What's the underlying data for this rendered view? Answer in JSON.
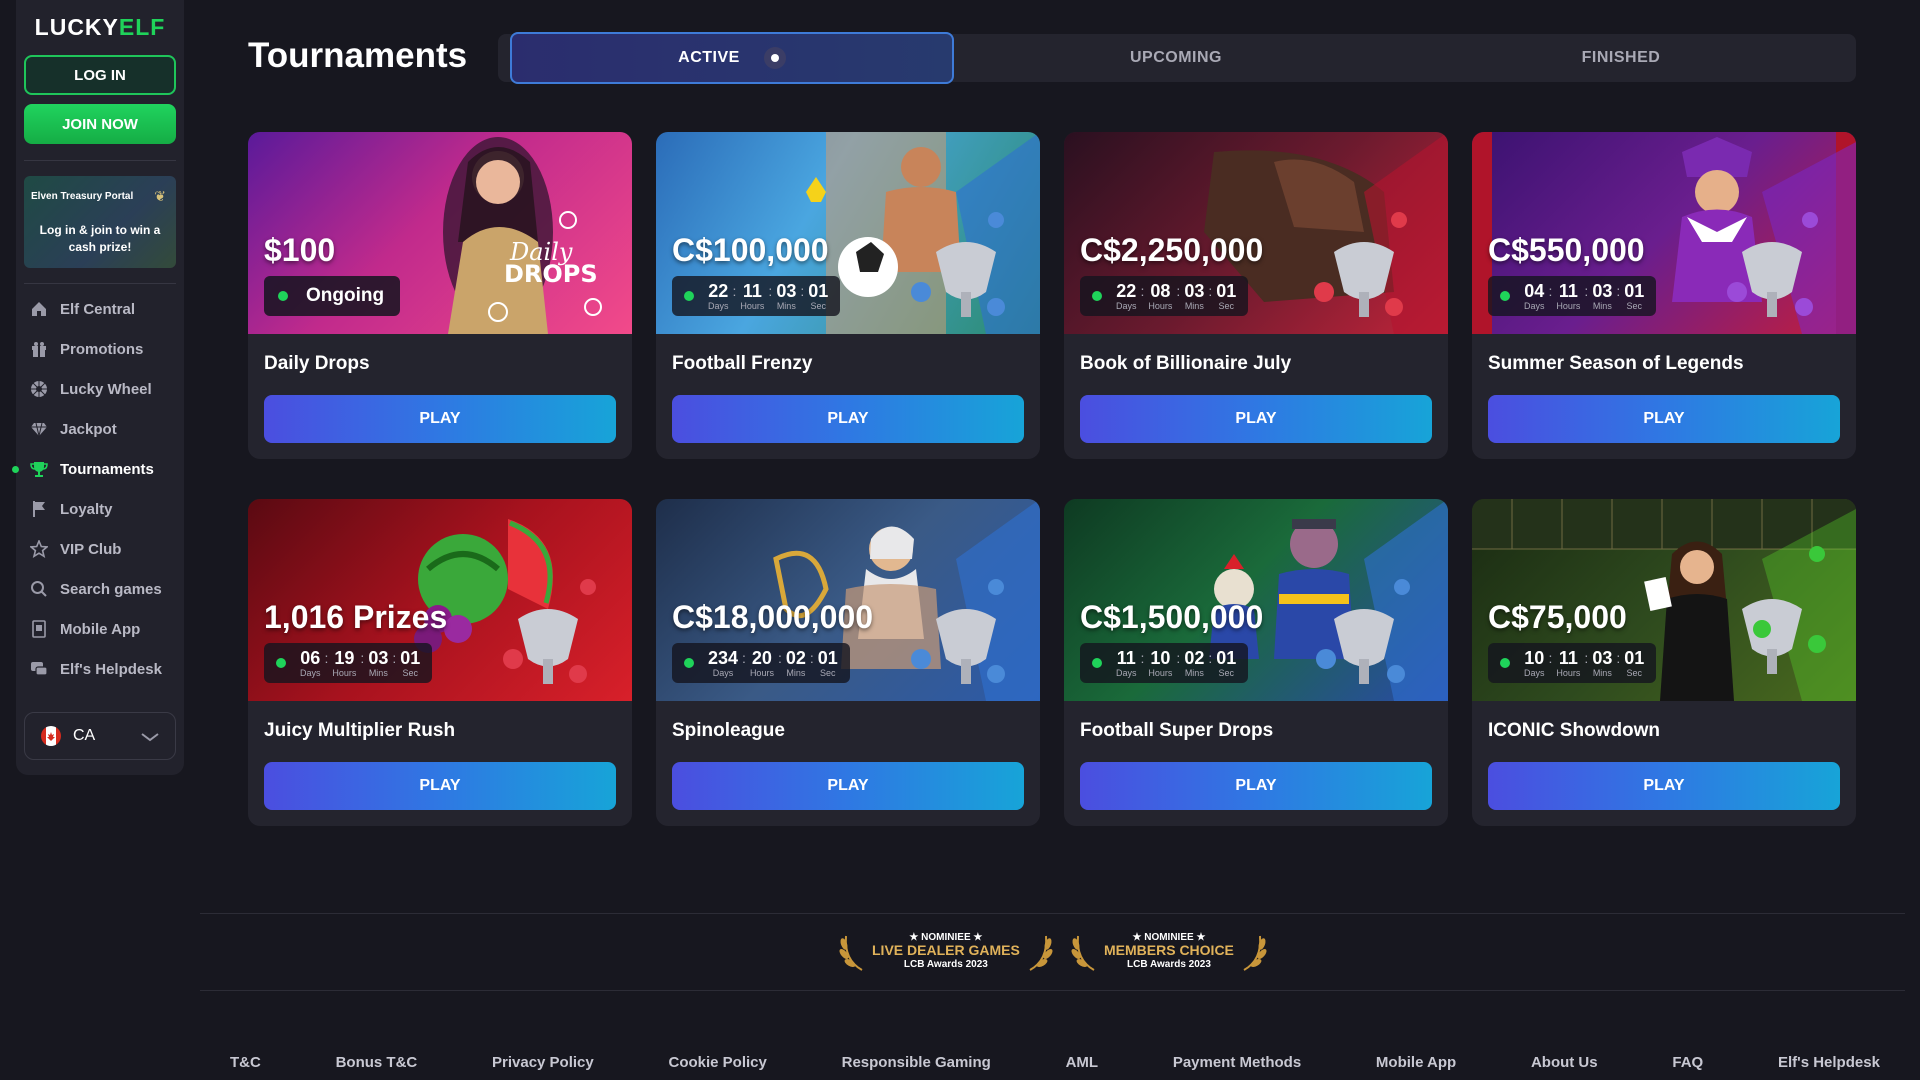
{
  "brand": {
    "logo_left": "LUCKY",
    "logo_right": "ELF"
  },
  "auth": {
    "login_label": "LOG IN",
    "join_label": "JOIN NOW"
  },
  "promo": {
    "title": "Elven Treasury Portal",
    "text": "Log in & join to win a cash prize!"
  },
  "sidebar": {
    "items": [
      {
        "label": "Elf Central",
        "icon": "home-icon"
      },
      {
        "label": "Promotions",
        "icon": "gift-icon"
      },
      {
        "label": "Lucky Wheel",
        "icon": "wheel-icon"
      },
      {
        "label": "Jackpot",
        "icon": "diamond-icon"
      },
      {
        "label": "Tournaments",
        "icon": "trophy-icon",
        "active": true
      },
      {
        "label": "Loyalty",
        "icon": "flag-icon"
      },
      {
        "label": "VIP Club",
        "icon": "star-icon"
      },
      {
        "label": "Search games",
        "icon": "search-icon"
      },
      {
        "label": "Mobile App",
        "icon": "mobile-icon"
      },
      {
        "label": "Elf's Helpdesk",
        "icon": "helpdesk-icon"
      }
    ],
    "language": "CA"
  },
  "page": {
    "title": "Tournaments"
  },
  "tabs": [
    {
      "label": "ACTIVE",
      "active": true
    },
    {
      "label": "UPCOMING",
      "active": false
    },
    {
      "label": "FINISHED",
      "active": false
    }
  ],
  "timer_labels": {
    "days": "Days",
    "hours": "Hours",
    "mins": "Mins",
    "sec": "Sec"
  },
  "cards": [
    {
      "name": "Daily Drops",
      "prize": "$100",
      "status": "Ongoing",
      "play": "PLAY"
    },
    {
      "name": "Football Frenzy",
      "prize": "C$100,000",
      "days": "22",
      "hours": "11",
      "mins": "03",
      "sec": "01",
      "play": "PLAY"
    },
    {
      "name": "Book of Billionaire July",
      "prize": "C$2,250,000",
      "days": "22",
      "hours": "08",
      "mins": "03",
      "sec": "01",
      "play": "PLAY"
    },
    {
      "name": "Summer Season of Legends",
      "prize": "C$550,000",
      "days": "04",
      "hours": "11",
      "mins": "03",
      "sec": "01",
      "play": "PLAY"
    },
    {
      "name": "Juicy Multiplier Rush",
      "prize": "1,016 Prizes",
      "days": "06",
      "hours": "19",
      "mins": "03",
      "sec": "01",
      "play": "PLAY"
    },
    {
      "name": "Spinoleague",
      "prize": "C$18,000,000",
      "days": "234",
      "hours": "20",
      "mins": "02",
      "sec": "01",
      "play": "PLAY"
    },
    {
      "name": "Football Super Drops",
      "prize": "C$1,500,000",
      "days": "11",
      "hours": "10",
      "mins": "02",
      "sec": "01",
      "play": "PLAY"
    },
    {
      "name": "ICONIC Showdown",
      "prize": "C$75,000",
      "days": "10",
      "hours": "11",
      "mins": "03",
      "sec": "01",
      "play": "PLAY"
    }
  ],
  "awards": [
    {
      "nominee": "★ NOMINIEE ★",
      "title": "LIVE DEALER GAMES",
      "sub": "LCB Awards 2023"
    },
    {
      "nominee": "★ NOMINIEE ★",
      "title": "MEMBERS CHOICE",
      "sub": "LCB Awards 2023"
    }
  ],
  "footer": [
    "T&C",
    "Bonus T&C",
    "Privacy Policy",
    "Cookie Policy",
    "Responsible Gaming",
    "AML",
    "Payment Methods",
    "Mobile App",
    "About Us",
    "FAQ",
    "Elf's Helpdesk"
  ]
}
